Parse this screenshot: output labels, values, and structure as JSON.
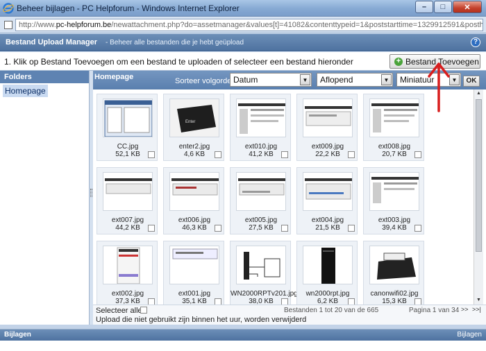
{
  "window": {
    "title": "Beheer bijlagen - PC Helpforum - Windows Internet Explorer",
    "url_prefix": "http://www.",
    "url_domain": "pc-helpforum.be",
    "url_rest": "/newattachment.php?do=assetmanager&values[t]=41082&contenttypeid=1&poststarttime=1329912591&posthash"
  },
  "manager": {
    "title": "Bestand Upload Manager",
    "subtitle": "- Beheer alle bestanden die je hebt geüpload",
    "help": "?"
  },
  "instruction": {
    "text": "1. Klik op Bestand Toevoegen om een bestand te uploaden of selecteer een bestand hieronder",
    "add_button": "Bestand Toevoegen"
  },
  "folders": {
    "heading": "Folders",
    "items": [
      "Homepage"
    ]
  },
  "main": {
    "folder_title": "Homepage",
    "sort_label": "Sorteer volgorde:",
    "sort_field": "Datum",
    "sort_order": "Aflopend",
    "view_mode": "Miniatuur",
    "ok": "OK"
  },
  "files": [
    {
      "name": "CC.jpg",
      "size": "52,1 KB"
    },
    {
      "name": "enter2.jpg",
      "size": "4,6 KB"
    },
    {
      "name": "ext010.jpg",
      "size": "41,2 KB"
    },
    {
      "name": "ext009.jpg",
      "size": "22,2 KB"
    },
    {
      "name": "ext008.jpg",
      "size": "20,7 KB"
    },
    {
      "name": "ext007.jpg",
      "size": "44,2 KB"
    },
    {
      "name": "ext006.jpg",
      "size": "46,3 KB"
    },
    {
      "name": "ext005.jpg",
      "size": "27,5 KB"
    },
    {
      "name": "ext004.jpg",
      "size": "21,5 KB"
    },
    {
      "name": "ext003.jpg",
      "size": "39,4 KB"
    },
    {
      "name": "ext002.jpg",
      "size": "37,3 KB"
    },
    {
      "name": "ext001.jpg",
      "size": "35,1 KB"
    },
    {
      "name": "WN2000RPTv201.jpg",
      "size": "38,0 KB"
    },
    {
      "name": "wn2000rpt.jpg",
      "size": "6,2 KB"
    },
    {
      "name": "canonwifi02.jpg",
      "size": "15,3 KB"
    }
  ],
  "footer": {
    "select_all": "Selecteer alle",
    "count": "Bestanden 1 tot 20 van de 665",
    "page": "Pagina 1 van 34",
    "first": "|<<",
    "prev": "<<",
    "next": ">>",
    "last": ">>|",
    "note": "Upload die niet gebruikt zijn binnen het uur, worden verwijderd"
  },
  "attachments": {
    "left": "Bijlagen",
    "right": "Bijlagen"
  }
}
